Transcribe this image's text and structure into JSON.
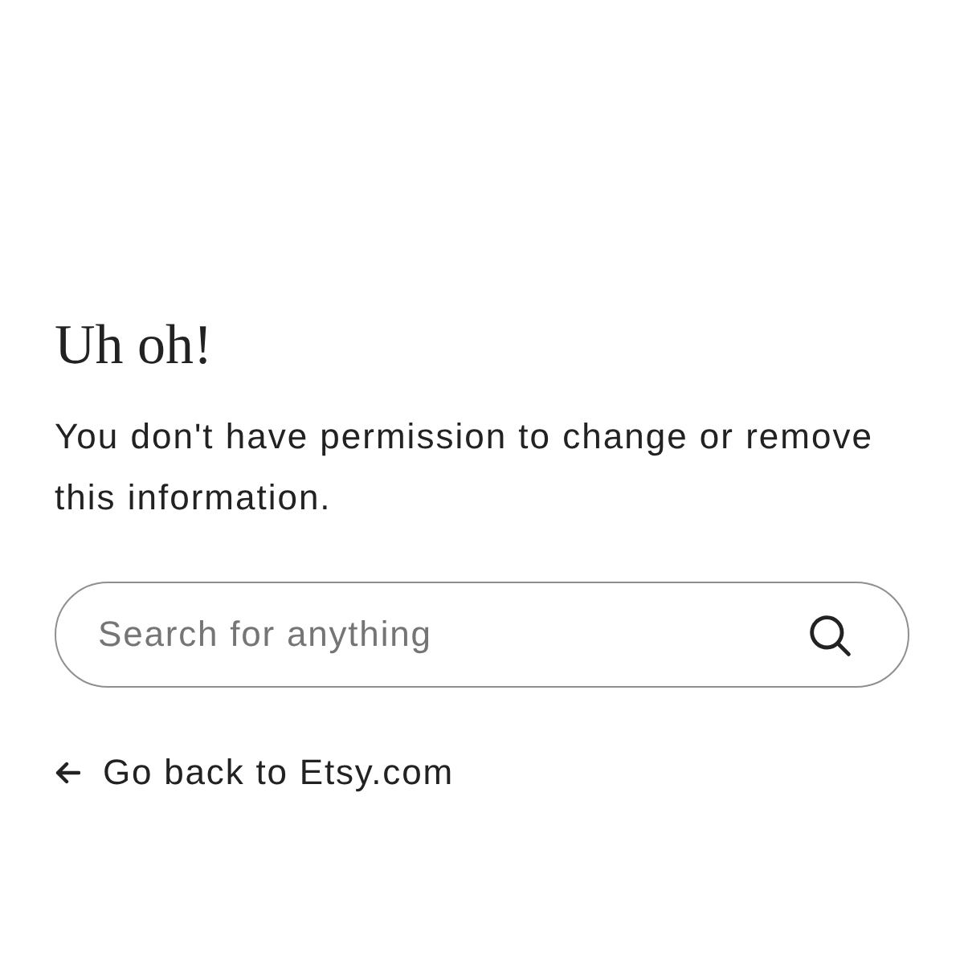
{
  "heading": "Uh oh!",
  "message": "You don't have permission to change or remove this information.",
  "search": {
    "placeholder": "Search for anything"
  },
  "back_link": {
    "label": "Go back to Etsy.com"
  }
}
